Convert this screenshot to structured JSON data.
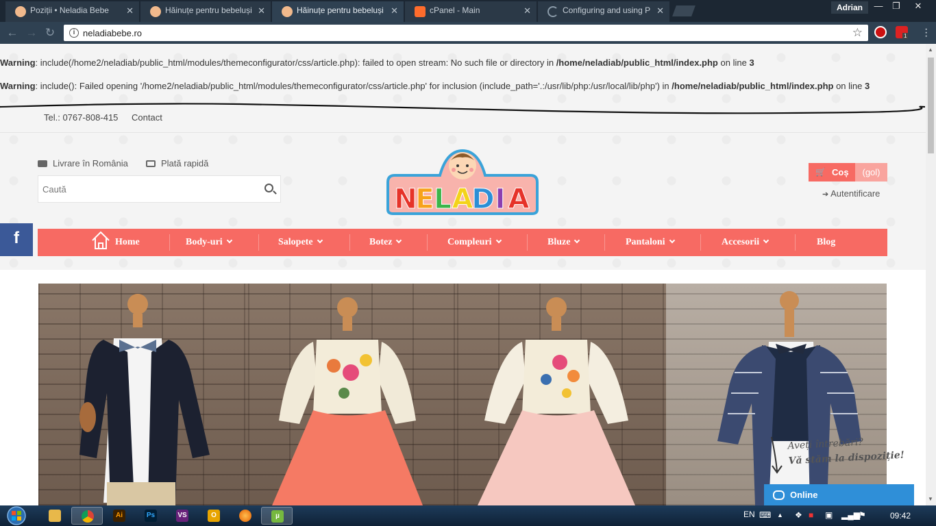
{
  "browser": {
    "tabs": [
      {
        "title": "Poziții • Neladia Bebe",
        "icon_color": "#f1b98c"
      },
      {
        "title": "Hăinuțe pentru bebeluși",
        "icon_color": "#f1b98c"
      },
      {
        "title": "Hăinuțe pentru bebeluși",
        "icon_color": "#f1b98c"
      },
      {
        "title": "cPanel - Main",
        "icon_color": "#ff6c2c"
      },
      {
        "title": "Configuring and using P",
        "icon_color": "#8a9aa8"
      }
    ],
    "active_tab_index": 2,
    "profile_name": "Adrian",
    "url": "neladiabebe.ro",
    "extension_badge": "1"
  },
  "warnings": [
    {
      "label": "Warning",
      "message": ": include(/home2/neladiab/public_html/modules/themeconfigurator/css/article.php): failed to open stream: No such file or directory in ",
      "path": "/home/neladiab/public_html/index.php",
      "suffix": " on line ",
      "line": "3"
    },
    {
      "label": "Warning",
      "message": ": include(): Failed opening '/home2/neladiab/public_html/modules/themeconfigurator/css/article.php' for inclusion (include_path='.:/usr/lib/php:/usr/local/lib/php') in ",
      "path": "/home/neladiab/public_html/index.php",
      "suffix": " on line ",
      "line": "3"
    }
  ],
  "topbar": {
    "phone": "Tel.: 0767-808-415",
    "contact": "Contact"
  },
  "header": {
    "delivery": "Livrare în România",
    "payment": "Plată rapidă",
    "search_placeholder": "Caută",
    "logo_text": "NELADIA",
    "cart_label": "Coș",
    "cart_status": "(gol)",
    "login": "Autentificare"
  },
  "nav": {
    "items": [
      {
        "label": "Home",
        "dropdown": false
      },
      {
        "label": "Body-uri",
        "dropdown": true
      },
      {
        "label": "Salopete",
        "dropdown": true
      },
      {
        "label": "Botez",
        "dropdown": true
      },
      {
        "label": "Compleuri",
        "dropdown": true
      },
      {
        "label": "Bluze",
        "dropdown": true
      },
      {
        "label": "Pantaloni",
        "dropdown": true
      },
      {
        "label": "Accesorii",
        "dropdown": true
      },
      {
        "label": "Blog",
        "dropdown": false
      }
    ]
  },
  "social": {
    "facebook": "f"
  },
  "chat": {
    "tagline_1": "Aveți întrebări?",
    "tagline_2": "Vă stăm la dispoziție!",
    "status": "Online"
  },
  "colors": {
    "accent": "#f76a63",
    "facebook": "#3b5998",
    "chat": "#2f8fd8"
  },
  "taskbar": {
    "apps": [
      "file-explorer",
      "chrome",
      "illustrator",
      "photoshop",
      "visual-studio",
      "outlook",
      "firefox",
      "utorrent"
    ],
    "language": "EN",
    "time": "09:42"
  }
}
